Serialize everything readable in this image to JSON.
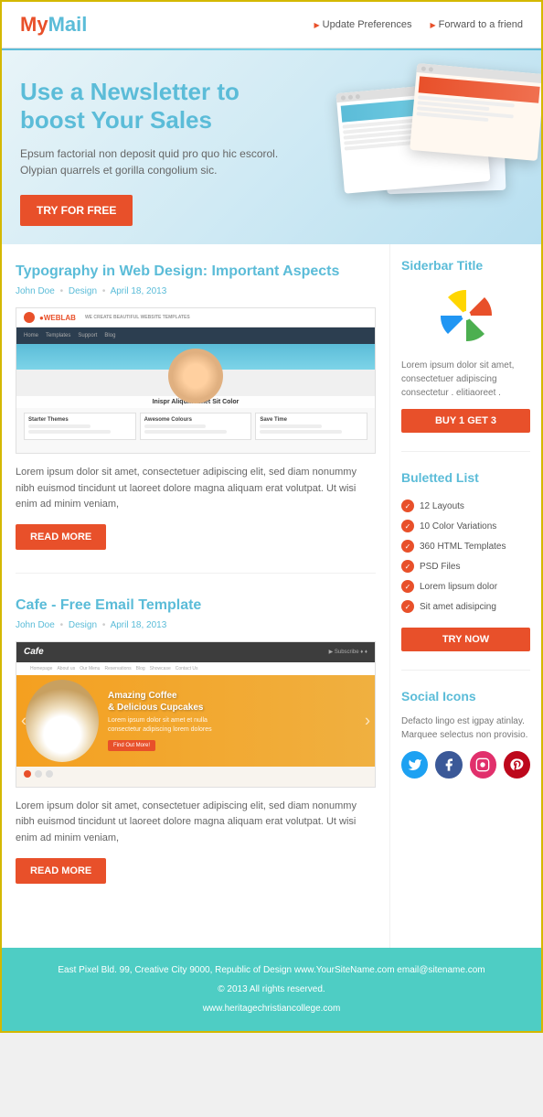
{
  "header": {
    "logo_my": "My",
    "logo_mail": "Mail",
    "link1": "Update Preferences",
    "link2": "Forward to a friend"
  },
  "hero": {
    "title_line1": "Use a Newsletter to",
    "title_line2": "boost Your Sales",
    "description": "Epsum factorial non deposit quid pro quo hic escorol. Olypian quarrels et gorilla congolium sic.",
    "cta_button": "TRY FOR FREE"
  },
  "articles": [
    {
      "title": "Typography in Web Design: Important Aspects",
      "author": "John Doe",
      "category": "Design",
      "date": "April 18, 2013",
      "body": "Lorem ipsum dolor sit amet, consectetuer adipiscing elit, sed diam nonummy nibh euismod tincidunt ut laoreet dolore magna aliquam erat volutpat. Ut wisi enim ad minim veniam,",
      "read_more": "READ MORE"
    },
    {
      "title": "Cafe - Free Email Template",
      "author": "John Doe",
      "category": "Design",
      "date": "April 18, 2013",
      "body": "Lorem ipsum dolor sit amet, consectetuer adipiscing elit, sed diam nonummy nibh euismod tincidunt ut laoreet dolore magna aliquam erat volutpat. Ut wisi enim ad minim veniam,",
      "read_more": "READ MORE"
    }
  ],
  "sidebar": {
    "title1": "Siderbar Title",
    "sidebar_text": "Lorem ipsum dolor sit amet, consectetuer adipiscing consectetur . elitiaoreet .",
    "buy_button": "BUY 1 GET 3",
    "title2": "Buletted List",
    "list_items": [
      "12 Layouts",
      "10 Color Variations",
      "360 HTML Templates",
      "PSD Files",
      "Lorem lipsum dolor",
      "Sit amet adisipcing"
    ],
    "try_button": "TRY NOW",
    "title3": "Social Icons",
    "social_text": "Defacto lingo est igpay atinlay. Marquee selectus non provisio."
  },
  "footer": {
    "address": "East Pixel Bld. 99, Creative City 9000, Republic of Design www.YourSiteName.com email@sitename.com",
    "copyright": "© 2013 All rights reserved.",
    "url": "www.heritagechristiancollege.com"
  },
  "colors": {
    "teal": "#5bbcd8",
    "orange": "#e8502a",
    "footer_bg": "#4ecdc4"
  }
}
